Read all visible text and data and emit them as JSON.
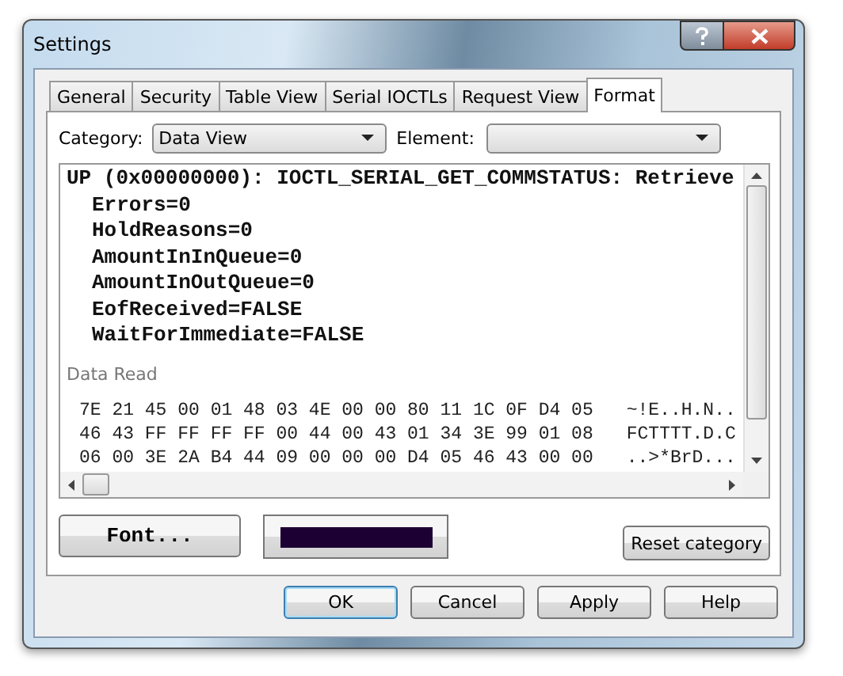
{
  "window": {
    "title": "Settings"
  },
  "tabs": [
    {
      "label": "General",
      "selected": false
    },
    {
      "label": "Security",
      "selected": false
    },
    {
      "label": "Table View",
      "selected": false
    },
    {
      "label": "Serial IOCTLs",
      "selected": false
    },
    {
      "label": "Request View",
      "selected": false
    },
    {
      "label": "Format",
      "selected": true
    }
  ],
  "category": {
    "label": "Category:",
    "value": "Data View"
  },
  "element": {
    "label": "Element:"
  },
  "preview": {
    "header": "UP (0x00000000): IOCTL_SERIAL_GET_COMMSTATUS: Retrieve",
    "fields": [
      "Errors=0",
      "HoldReasons=0",
      "AmountInInQueue=0",
      "AmountInOutQueue=0",
      "EofReceived=FALSE",
      "WaitForImmediate=FALSE"
    ],
    "section": "Data Read",
    "hex_rows": [
      {
        "hex": "7E 21 45 00 01 48 03 4E 00 00 80 11 1C 0F D4 05",
        "ascii": "~!E..H.N.."
      },
      {
        "hex": "46 43 FF FF FF FF 00 44 00 43 01 34 3E 99 01 08",
        "ascii": "FCTTTT.D.C"
      },
      {
        "hex": "06 00 3E 2A B4 44 09 00 00 00 D4 05 46 43 00 00",
        "ascii": "..>*BrD..."
      }
    ]
  },
  "font_button": {
    "label": "Font..."
  },
  "color_button": {
    "color": "#1c0033"
  },
  "reset_button": {
    "label": "Reset category"
  },
  "buttons": [
    {
      "label": "OK",
      "default": true
    },
    {
      "label": "Cancel",
      "default": false
    },
    {
      "label": "Apply",
      "default": false
    },
    {
      "label": "Help",
      "default": false
    }
  ]
}
